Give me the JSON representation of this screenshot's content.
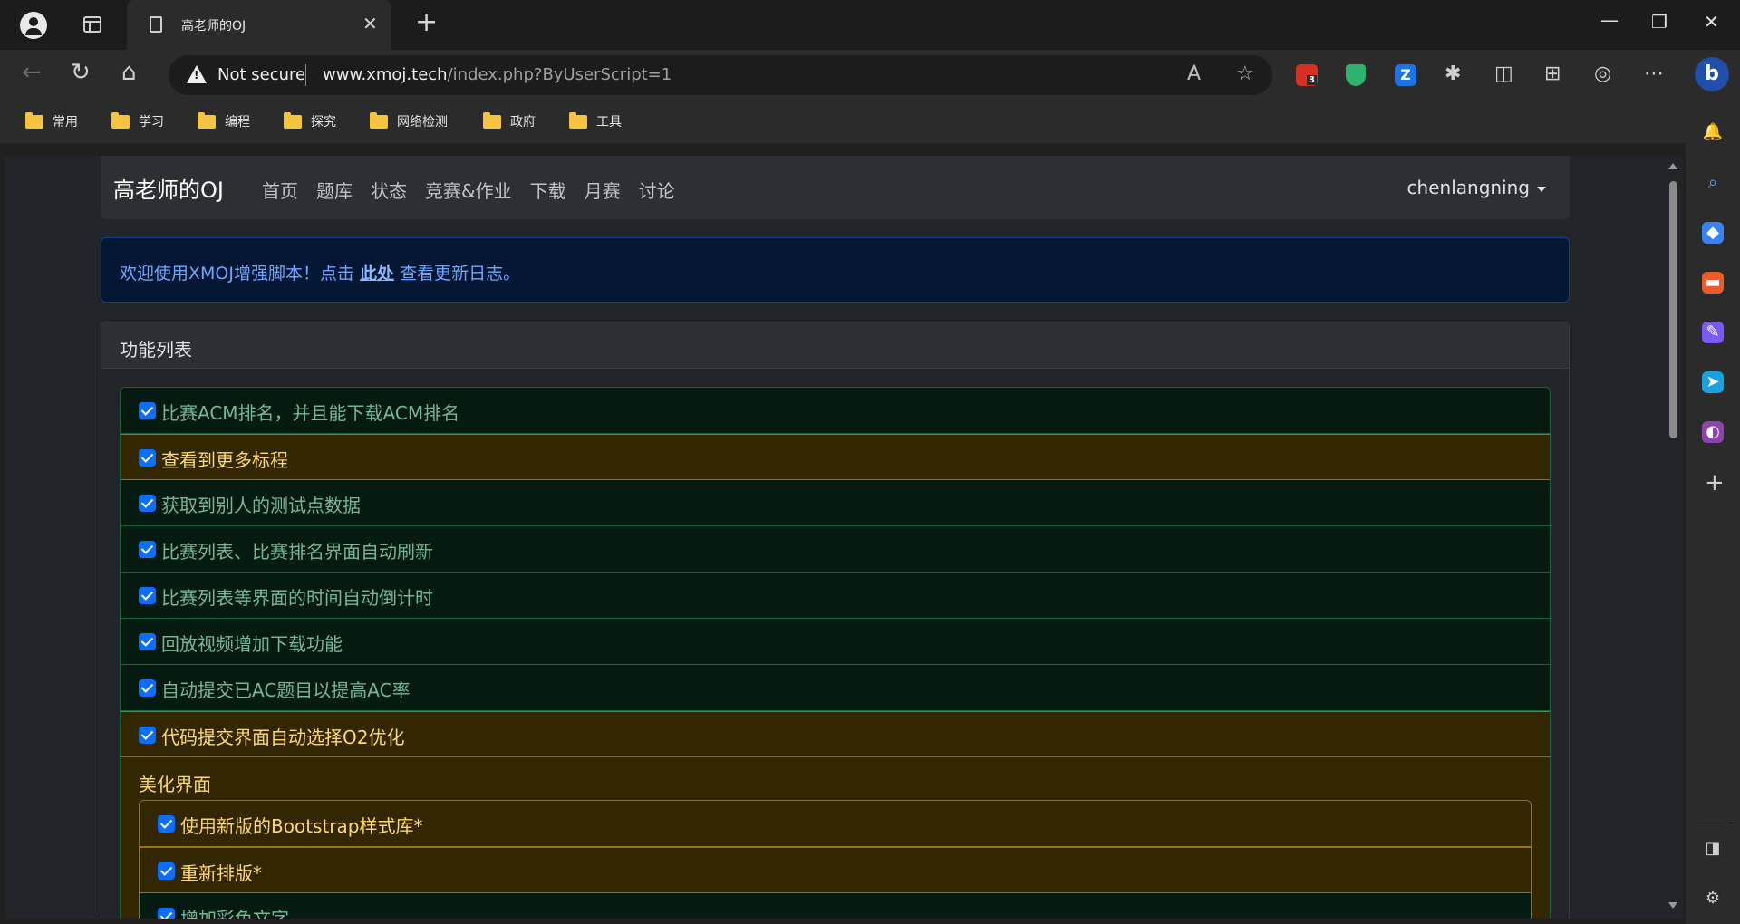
{
  "browser": {
    "tab_title": "高老师的OJ",
    "address": {
      "security_label": "Not secure",
      "url_host": "www.xmoj.tech",
      "url_path": "/index.php?ByUserScript=1"
    },
    "extension_badge": "3",
    "bookmarks": [
      "常用",
      "学习",
      "编程",
      "探究",
      "网络检测",
      "政府",
      "工具"
    ]
  },
  "site": {
    "brand": "高老师的OJ",
    "nav": [
      "首页",
      "题库",
      "状态",
      "竞赛&作业",
      "下载",
      "月赛",
      "讨论"
    ],
    "user": "chenlangning",
    "alert": {
      "before": "欢迎使用XMOJ增强脚本！点击 ",
      "link": "此处",
      "after": " 查看更新日志。"
    },
    "card_title": "功能列表",
    "features": [
      {
        "label": "比赛ACM排名，并且能下载ACM排名",
        "style": "ok"
      },
      {
        "label": "查看到更多标程",
        "style": "warn"
      },
      {
        "label": "获取到别人的测试点数据",
        "style": "ok"
      },
      {
        "label": "比赛列表、比赛排名界面自动刷新",
        "style": "ok"
      },
      {
        "label": "比赛列表等界面的时间自动倒计时",
        "style": "ok"
      },
      {
        "label": "回放视频增加下载功能",
        "style": "ok"
      },
      {
        "label": "自动提交已AC题目以提高AC率",
        "style": "ok"
      },
      {
        "label": "代码提交界面自动选择O2优化",
        "style": "warn"
      }
    ],
    "group": {
      "title": "美化界面",
      "items": [
        {
          "label": "使用新版的Bootstrap样式库*",
          "style": "warn"
        },
        {
          "label": "重新排版*",
          "style": "warn"
        },
        {
          "label": "增加彩色文字",
          "style": "ok"
        }
      ]
    }
  }
}
